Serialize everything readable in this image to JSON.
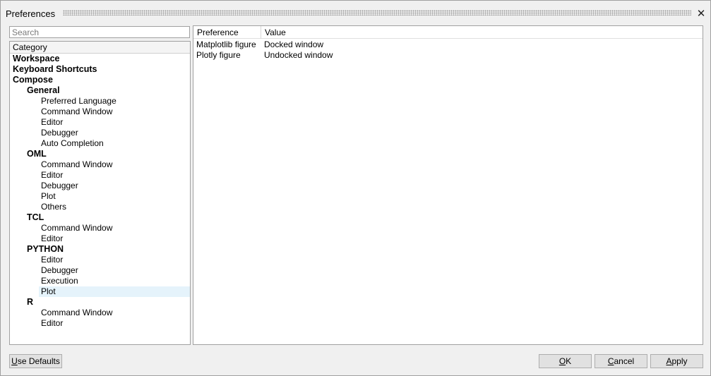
{
  "window": {
    "title": "Preferences",
    "close_glyph": "✕"
  },
  "search": {
    "placeholder": "Search",
    "value": ""
  },
  "tree": {
    "header": "Category",
    "items": [
      {
        "label": "Workspace",
        "level": 0,
        "bold": true
      },
      {
        "label": "Keyboard Shortcuts",
        "level": 0,
        "bold": true
      },
      {
        "label": "Compose",
        "level": 0,
        "bold": true
      },
      {
        "label": "General",
        "level": 1,
        "bold": true
      },
      {
        "label": "Preferred Language",
        "level": 2,
        "bold": false
      },
      {
        "label": "Command Window",
        "level": 2,
        "bold": false
      },
      {
        "label": "Editor",
        "level": 2,
        "bold": false
      },
      {
        "label": "Debugger",
        "level": 2,
        "bold": false
      },
      {
        "label": "Auto Completion",
        "level": 2,
        "bold": false
      },
      {
        "label": "OML",
        "level": 1,
        "bold": true
      },
      {
        "label": "Command Window",
        "level": 2,
        "bold": false
      },
      {
        "label": "Editor",
        "level": 2,
        "bold": false
      },
      {
        "label": "Debugger",
        "level": 2,
        "bold": false
      },
      {
        "label": "Plot",
        "level": 2,
        "bold": false
      },
      {
        "label": "Others",
        "level": 2,
        "bold": false
      },
      {
        "label": "TCL",
        "level": 1,
        "bold": true
      },
      {
        "label": "Command Window",
        "level": 2,
        "bold": false
      },
      {
        "label": "Editor",
        "level": 2,
        "bold": false
      },
      {
        "label": "PYTHON",
        "level": 1,
        "bold": true
      },
      {
        "label": "Editor",
        "level": 2,
        "bold": false
      },
      {
        "label": "Debugger",
        "level": 2,
        "bold": false
      },
      {
        "label": "Execution",
        "level": 2,
        "bold": false
      },
      {
        "label": "Plot",
        "level": 2,
        "bold": false,
        "selected": true
      },
      {
        "label": "R",
        "level": 1,
        "bold": true
      },
      {
        "label": "Command Window",
        "level": 2,
        "bold": false
      },
      {
        "label": "Editor",
        "level": 2,
        "bold": false
      }
    ]
  },
  "table": {
    "columns": [
      "Preference",
      "Value"
    ],
    "rows": [
      [
        "Matplotlib figure",
        "Docked window"
      ],
      [
        "Plotly figure",
        "Undocked window"
      ]
    ]
  },
  "buttons": {
    "use_defaults": {
      "mnemonic": "U",
      "rest": "se Defaults"
    },
    "ok": {
      "mnemonic": "O",
      "rest": "K"
    },
    "cancel": {
      "mnemonic": "C",
      "rest": "ancel"
    },
    "apply": {
      "mnemonic": "A",
      "rest": "pply"
    }
  },
  "colors": {
    "selection": "#e5f3fb",
    "window_bg": "#f0f0f0",
    "border": "#a0a0a0"
  }
}
